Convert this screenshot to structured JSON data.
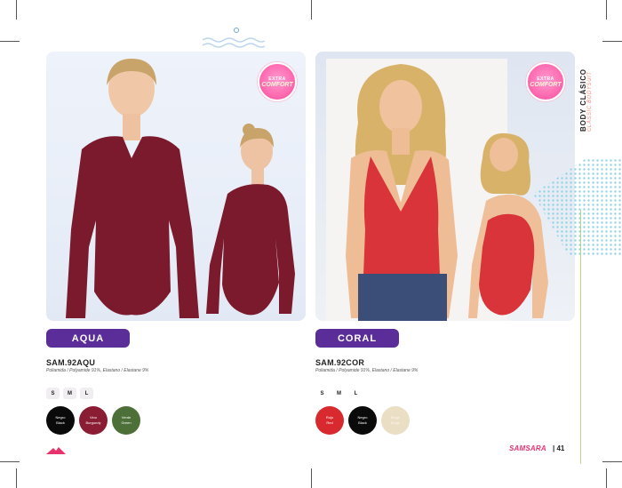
{
  "side_title": {
    "main": "BODY CLÁSICO",
    "sub": "CLASSIC BODYSUIT"
  },
  "badge_label": {
    "line1": "EXTRA",
    "line2": "COMFORT"
  },
  "products": [
    {
      "name": "AQUA",
      "code": "SAM.92AQU",
      "fabric": "Poliamida / Polyamide 91%, Elastano / Elastane 9%",
      "sizes": [
        "S",
        "M",
        "L"
      ],
      "colors": [
        {
          "es": "Negro",
          "en": "Black",
          "hex": "#0a0a0a",
          "text": "#ffffff"
        },
        {
          "es": "Vino",
          "en": "Burgundy",
          "hex": "#8a1c34",
          "text": "#ffffff"
        },
        {
          "es": "Verde",
          "en": "Green",
          "hex": "#4d7039",
          "text": "#ffffff"
        }
      ],
      "garment_color": "#7b1a2c"
    },
    {
      "name": "CORAL",
      "code": "SAM.92COR",
      "fabric": "Poliamida / Polyamide 91%, Elastano / Elastane 9%",
      "sizes": [
        "S",
        "M",
        "L"
      ],
      "colors": [
        {
          "es": "Rojo",
          "en": "Red",
          "hex": "#d82a2e",
          "text": "#ffffff"
        },
        {
          "es": "Negro",
          "en": "Black",
          "hex": "#0a0a0a",
          "text": "#ffffff"
        },
        {
          "es": "Beige",
          "en": "Beige",
          "hex": "#eadfc4",
          "text": "#fbf6ea"
        }
      ],
      "garment_color": "#d8343a"
    }
  ],
  "footer": {
    "brand": "SAMSARA",
    "page": "| 41"
  },
  "colors": {
    "pill": "#5b2d99",
    "accent_pink": "#e7336d",
    "accent_green": "#b8d78a",
    "dots": "#8fd3e6"
  }
}
